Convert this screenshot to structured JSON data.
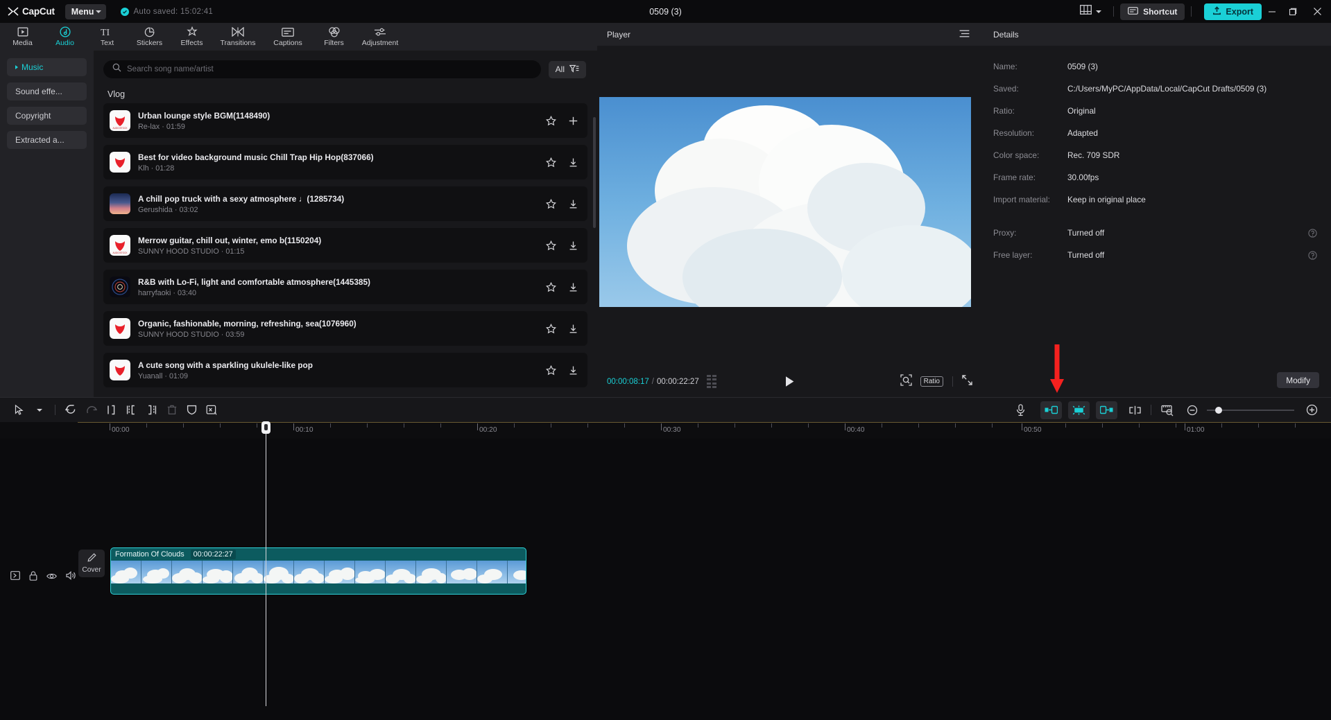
{
  "app": {
    "brand": "CapCut",
    "menu_label": "Menu",
    "autosave_text": "Auto saved: 15:02:41",
    "window_title": "0509 (3)",
    "shortcut_label": "Shortcut",
    "export_label": "Export",
    "accent": "#1ad0d6",
    "annotation_color": "#f5211f"
  },
  "tabs": [
    {
      "label": "Media",
      "icon": "media-icon",
      "active": false
    },
    {
      "label": "Audio",
      "icon": "audio-icon",
      "active": true
    },
    {
      "label": "Text",
      "icon": "text-icon",
      "active": false
    },
    {
      "label": "Stickers",
      "icon": "stickers-icon",
      "active": false
    },
    {
      "label": "Effects",
      "icon": "effects-icon",
      "active": false
    },
    {
      "label": "Transitions",
      "icon": "transitions-icon",
      "active": false
    },
    {
      "label": "Captions",
      "icon": "captions-icon",
      "active": false
    },
    {
      "label": "Filters",
      "icon": "filters-icon",
      "active": false
    },
    {
      "label": "Adjustment",
      "icon": "adjustment-icon",
      "active": false
    }
  ],
  "sidebar": {
    "items": [
      {
        "label": "Music",
        "active": true
      },
      {
        "label": "Sound effe...",
        "active": false
      },
      {
        "label": "Copyright",
        "active": false
      },
      {
        "label": "Extracted a...",
        "active": false
      }
    ]
  },
  "music": {
    "search_placeholder": "Search song name/artist",
    "search_value": "",
    "filter_label": "All",
    "section_label": "Vlog",
    "songs": [
      {
        "title": "Urban lounge style BGM(1148490)",
        "artist": "Re-lax",
        "duration": "01:59",
        "thumb": "logo-red",
        "action": "add"
      },
      {
        "title": "Best for video background music Chill Trap Hip Hop(837066)",
        "artist": "Klh",
        "duration": "01:28",
        "thumb": "logo-red",
        "action": "download"
      },
      {
        "title": "A chill pop truck with a sexy atmosphere ♩(1285734)",
        "artist": "Gerushida",
        "duration": "03:02",
        "thumb": "photo-sky",
        "action": "download"
      },
      {
        "title": "Merrow guitar, chill out, winter, emo b(1150204)",
        "artist": "SUNNY HOOD STUDIO",
        "duration": "01:15",
        "thumb": "logo-red",
        "action": "download"
      },
      {
        "title": "R&B with Lo-Fi, light and comfortable atmosphere(1445385)",
        "artist": "harryfaoki",
        "duration": "03:40",
        "thumb": "photo-dark",
        "action": "download"
      },
      {
        "title": "Organic, fashionable, morning, refreshing, sea(1076960)",
        "artist": "SUNNY HOOD STUDIO",
        "duration": "03:59",
        "thumb": "logo-red",
        "action": "download"
      },
      {
        "title": "A cute song with a sparkling ukulele-like pop",
        "artist": "Yuanall",
        "duration": "01:09",
        "thumb": "logo-red",
        "action": "download"
      }
    ]
  },
  "player": {
    "header_title": "Player",
    "current_time": "00:00:08:17",
    "separator": "/",
    "total_time": "00:00:22:27",
    "ratio_label": "Ratio"
  },
  "details": {
    "header_title": "Details",
    "rows": [
      {
        "label": "Name:",
        "value": "0509 (3)",
        "help": false
      },
      {
        "label": "Saved:",
        "value": "C:/Users/MyPC/AppData/Local/CapCut Drafts/0509 (3)",
        "help": false
      },
      {
        "label": "Ratio:",
        "value": "Original",
        "help": false
      },
      {
        "label": "Resolution:",
        "value": "Adapted",
        "help": false
      },
      {
        "label": "Color space:",
        "value": "Rec. 709 SDR",
        "help": false
      },
      {
        "label": "Frame rate:",
        "value": "30.00fps",
        "help": false
      },
      {
        "label": "Import material:",
        "value": "Keep in original place",
        "help": false
      }
    ],
    "rows2": [
      {
        "label": "Proxy:",
        "value": "Turned off",
        "help": true
      },
      {
        "label": "Free layer:",
        "value": "Turned off",
        "help": true
      }
    ],
    "modify_label": "Modify"
  },
  "timeline": {
    "ruler_labels": [
      "00:00",
      "00:10",
      "00:20",
      "00:30",
      "00:40",
      "00:50",
      "01:00"
    ],
    "ruler_positions": [
      157,
      422,
      687,
      952,
      1217,
      1472,
      1707
    ],
    "playhead_time": "00:00:08:17",
    "cover_label": "Cover",
    "clip": {
      "name": "Formation Of Clouds",
      "duration": "00:00:22:27",
      "frame_count": 11
    },
    "toolbar_left": [
      "select-tool",
      "undo",
      "redo",
      "split",
      "trim-left",
      "trim-right",
      "delete",
      "mask",
      "mute-audio"
    ],
    "toolbar_right": [
      "record-voiceover",
      "keyframe-in",
      "auto-beat",
      "keyframe-out",
      "mirror",
      "zoom-fit",
      "zoom-out",
      "zoom-slider",
      "zoom-in"
    ],
    "highlighted_tool": "record-voiceover"
  }
}
